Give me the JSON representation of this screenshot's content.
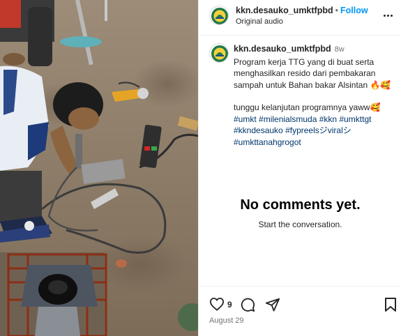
{
  "post": {
    "username": "kkn.desauko_umktfpbd",
    "follow_label": "Follow",
    "separator": "•",
    "audio": "Original audio",
    "age": "8w",
    "caption_line1": "Program kerja TTG yang di buat serta menghasilkan resido dari pembakaran sampah untuk Bahan bakar Alsintan 🔥🥰",
    "caption_line2": "tunggu kelanjutan programnya yaww🥰",
    "hashtags": [
      "#umkt",
      "#milenialsmuda",
      "#kkn",
      "#umkttgt",
      "#kkndesauko",
      "#fypreelsジviralシ",
      "#umkttanahgrogot"
    ],
    "comments_empty_title": "No comments yet.",
    "comments_empty_sub": "Start the conversation.",
    "likes": "9",
    "date": "August 29"
  },
  "icons": {
    "more": "more-options-icon",
    "like": "heart-icon",
    "comment": "comment-icon",
    "share": "share-icon",
    "save": "bookmark-icon"
  },
  "colors": {
    "link": "#0095f6",
    "hashtag": "#00376b",
    "muted": "#737373",
    "text": "#262626"
  }
}
